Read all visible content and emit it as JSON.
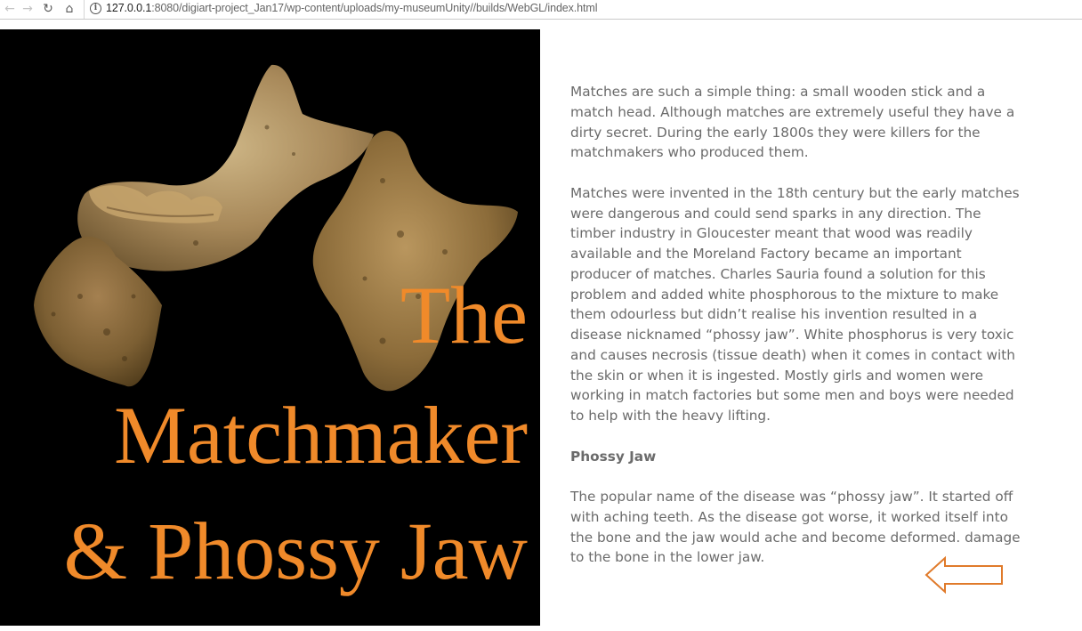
{
  "browser": {
    "url_host": "127.0.0.1",
    "url_rest": ":8080/digiart-project_Jan17/wp-content/uploads/my-museumUnity//builds/WebGL/index.html",
    "back_glyph": "←",
    "forward_glyph": "→",
    "reload_glyph": "↻",
    "home_glyph": "⌂",
    "info_glyph": "i"
  },
  "poster": {
    "title_line1": "The",
    "title_line2": "Matchmaker",
    "title_line3": "& Phossy Jaw",
    "title_color": "#f08a2a",
    "image_subject": "jaw bone fragments"
  },
  "article": {
    "paragraph1": "Matches are such a simple thing: a small wooden stick and a match head. Although matches are extremely useful they have a dirty secret. During the early 1800s they were killers for the matchmakers who produced them.",
    "paragraph2": "Matches were invented in the 18th century but the early matches were dangerous and could send sparks in any direction. The timber industry in Gloucester meant that wood was readily available and the Moreland Factory became an important producer of matches. Charles Sauria found a solution for this problem and added white phosphorous to the mixture to make them odourless but didn’t realise his invention resulted in a disease nicknamed “phossy jaw”. White phosphorus is very toxic and causes necrosis (tissue death) when it comes in contact with the skin or when it is ingested. Mostly girls and women were working in match factories but some men and boys were needed to help with the heavy lifting.",
    "heading": "Phossy Jaw",
    "paragraph3": "The popular name of the disease was “phossy jaw”. It started off with aching teeth. As the disease got worse, it worked itself into the bone and the jaw would ache and become deformed. damage to the bone in the lower jaw."
  },
  "navigation": {
    "back_arrow_icon": "left-arrow-outline-icon",
    "accent_color": "#e07a2a"
  }
}
